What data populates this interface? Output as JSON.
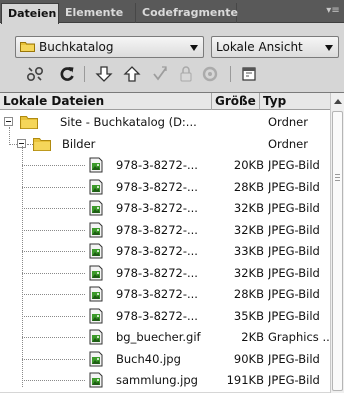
{
  "tabs": [
    {
      "label": "Dateien",
      "active": true
    },
    {
      "label": "Elemente",
      "active": false
    },
    {
      "label": "Codefragmente",
      "active": false
    }
  ],
  "site_select": {
    "value": "Buchkatalog",
    "icon": "folder-icon"
  },
  "view_select": {
    "value": "Lokale Ansicht"
  },
  "toolbar": {
    "icons": [
      "connect-icon",
      "refresh-icon",
      "get-files-icon",
      "put-files-icon",
      "check-out-icon",
      "check-in-icon",
      "synchronize-icon",
      "expand-view-icon"
    ]
  },
  "columns": {
    "name": "Lokale Dateien",
    "size": "Größe",
    "type": "Typ"
  },
  "tree": [
    {
      "level": 0,
      "kind": "folder",
      "name": "Site - Buchkatalog (D:...",
      "size": "",
      "type": "Ordner"
    },
    {
      "level": 1,
      "kind": "folder",
      "name": "Bilder",
      "size": "",
      "type": "Ordner"
    },
    {
      "level": 2,
      "kind": "file",
      "name": "978-3-8272-...",
      "size": "20KB",
      "type": "JPEG-Bild"
    },
    {
      "level": 2,
      "kind": "file",
      "name": "978-3-8272-...",
      "size": "28KB",
      "type": "JPEG-Bild"
    },
    {
      "level": 2,
      "kind": "file",
      "name": "978-3-8272-...",
      "size": "32KB",
      "type": "JPEG-Bild"
    },
    {
      "level": 2,
      "kind": "file",
      "name": "978-3-8272-...",
      "size": "32KB",
      "type": "JPEG-Bild"
    },
    {
      "level": 2,
      "kind": "file",
      "name": "978-3-8272-...",
      "size": "33KB",
      "type": "JPEG-Bild"
    },
    {
      "level": 2,
      "kind": "file",
      "name": "978-3-8272-...",
      "size": "32KB",
      "type": "JPEG-Bild"
    },
    {
      "level": 2,
      "kind": "file",
      "name": "978-3-8272-...",
      "size": "28KB",
      "type": "JPEG-Bild"
    },
    {
      "level": 2,
      "kind": "file",
      "name": "978-3-8272-...",
      "size": "35KB",
      "type": "JPEG-Bild"
    },
    {
      "level": 2,
      "kind": "file",
      "name": "bg_buecher.gif",
      "size": "2KB",
      "type": "Graphics ..."
    },
    {
      "level": 2,
      "kind": "file",
      "name": "Buch40.jpg",
      "size": "90KB",
      "type": "JPEG-Bild"
    },
    {
      "level": 2,
      "kind": "file",
      "name": "sammlung.jpg",
      "size": "191KB",
      "type": "JPEG-Bild"
    }
  ],
  "colors": {
    "folder": "#e8c23a",
    "folder_dark": "#b08a10",
    "image_icon_green": "#3c9a2a",
    "tab_bar": "#595959",
    "panel": "#d6d6d6"
  }
}
